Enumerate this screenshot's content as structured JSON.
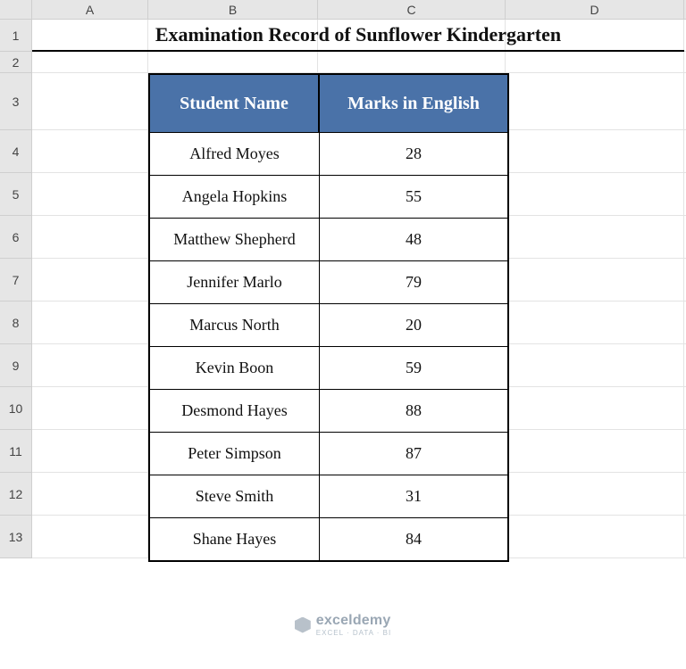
{
  "columns": [
    "A",
    "B",
    "C",
    "D"
  ],
  "rows": [
    "1",
    "2",
    "3",
    "4",
    "5",
    "6",
    "7",
    "8",
    "9",
    "10",
    "11",
    "12",
    "13"
  ],
  "title": "Examination Record of Sunflower Kindergarten",
  "table": {
    "headers": {
      "name": "Student Name",
      "marks": "Marks in English"
    },
    "data": [
      {
        "name": "Alfred Moyes",
        "marks": "28"
      },
      {
        "name": "Angela Hopkins",
        "marks": "55"
      },
      {
        "name": "Matthew Shepherd",
        "marks": "48"
      },
      {
        "name": "Jennifer Marlo",
        "marks": "79"
      },
      {
        "name": "Marcus North",
        "marks": "20"
      },
      {
        "name": "Kevin Boon",
        "marks": "59"
      },
      {
        "name": "Desmond Hayes",
        "marks": "88"
      },
      {
        "name": "Peter Simpson",
        "marks": "87"
      },
      {
        "name": "Steve Smith",
        "marks": "31"
      },
      {
        "name": "Shane Hayes",
        "marks": "84"
      }
    ]
  },
  "watermark": {
    "brand": "exceldemy",
    "tagline": "EXCEL · DATA · BI"
  }
}
